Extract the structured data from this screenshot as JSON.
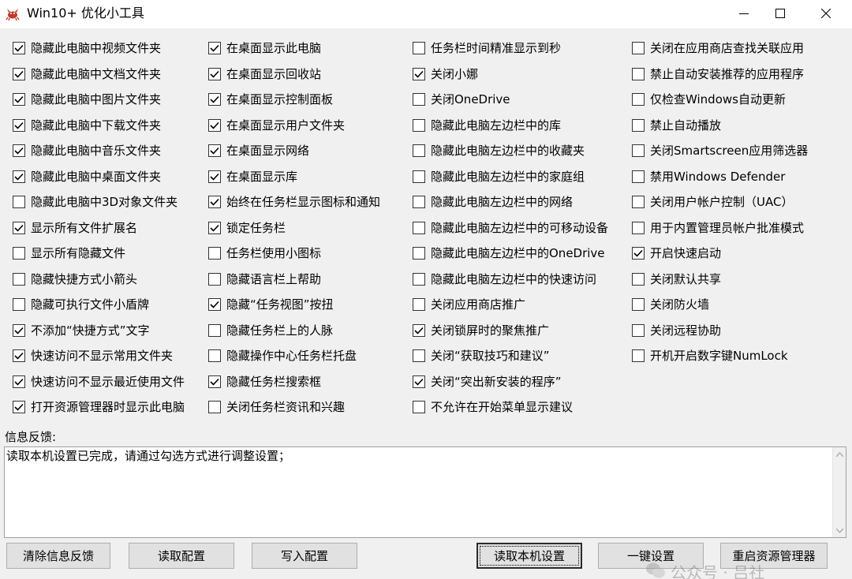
{
  "window": {
    "title": "Win10+ 优化小工具",
    "icon": "crab-app-icon"
  },
  "options": [
    [
      {
        "label": "隐藏此电脑中视频文件夹",
        "checked": true
      },
      {
        "label": "隐藏此电脑中文档文件夹",
        "checked": true
      },
      {
        "label": "隐藏此电脑中图片文件夹",
        "checked": true
      },
      {
        "label": "隐藏此电脑中下载文件夹",
        "checked": true
      },
      {
        "label": "隐藏此电脑中音乐文件夹",
        "checked": true
      },
      {
        "label": "隐藏此电脑中桌面文件夹",
        "checked": true
      },
      {
        "label": "隐藏此电脑中3D对象文件夹",
        "checked": false
      },
      {
        "label": "显示所有文件扩展名",
        "checked": true
      },
      {
        "label": "显示所有隐藏文件",
        "checked": false
      },
      {
        "label": "隐藏快捷方式小箭头",
        "checked": false
      },
      {
        "label": "隐藏可执行文件小盾牌",
        "checked": false
      },
      {
        "label": "不添加“快捷方式”文字",
        "checked": true
      },
      {
        "label": "快速访问不显示常用文件夹",
        "checked": true
      },
      {
        "label": "快速访问不显示最近使用文件",
        "checked": true
      },
      {
        "label": "打开资源管理器时显示此电脑",
        "checked": true
      }
    ],
    [
      {
        "label": "在桌面显示此电脑",
        "checked": true
      },
      {
        "label": "在桌面显示回收站",
        "checked": true
      },
      {
        "label": "在桌面显示控制面板",
        "checked": true
      },
      {
        "label": "在桌面显示用户文件夹",
        "checked": true
      },
      {
        "label": "在桌面显示网络",
        "checked": true
      },
      {
        "label": "在桌面显示库",
        "checked": true
      },
      {
        "label": "始终在任务栏显示图标和通知",
        "checked": true
      },
      {
        "label": "锁定任务栏",
        "checked": true
      },
      {
        "label": "任务栏使用小图标",
        "checked": false
      },
      {
        "label": "隐藏语言栏上帮助",
        "checked": false
      },
      {
        "label": "隐藏“任务视图”按扭",
        "checked": true
      },
      {
        "label": "隐藏任务栏上的人脉",
        "checked": false
      },
      {
        "label": "隐藏操作中心任务栏托盘",
        "checked": false
      },
      {
        "label": "隐藏任务栏搜索框",
        "checked": true
      },
      {
        "label": "关闭任务栏资讯和兴趣",
        "checked": false
      }
    ],
    [
      {
        "label": "任务栏时间精准显示到秒",
        "checked": false
      },
      {
        "label": "关闭小娜",
        "checked": true
      },
      {
        "label": "关闭OneDrive",
        "checked": false
      },
      {
        "label": "隐藏此电脑左边栏中的库",
        "checked": false
      },
      {
        "label": "隐藏此电脑左边栏中的收藏夹",
        "checked": false
      },
      {
        "label": "隐藏此电脑左边栏中的家庭组",
        "checked": false
      },
      {
        "label": "隐藏此电脑左边栏中的网络",
        "checked": false
      },
      {
        "label": "隐藏此电脑左边栏中的可移动设备",
        "checked": false
      },
      {
        "label": "隐藏此电脑左边栏中的OneDrive",
        "checked": false
      },
      {
        "label": "隐藏此电脑左边栏中的快速访问",
        "checked": false
      },
      {
        "label": "关闭应用商店推广",
        "checked": false
      },
      {
        "label": "关闭锁屏时的聚焦推广",
        "checked": true
      },
      {
        "label": "关闭“获取技巧和建议”",
        "checked": false
      },
      {
        "label": "关闭“突出新安装的程序”",
        "checked": true
      },
      {
        "label": "不允许在开始菜单显示建议",
        "checked": false
      }
    ],
    [
      {
        "label": "关闭在应用商店查找关联应用",
        "checked": false
      },
      {
        "label": "禁止自动安装推荐的应用程序",
        "checked": false
      },
      {
        "label": "仅检查Windows自动更新",
        "checked": false
      },
      {
        "label": "禁止自动播放",
        "checked": false
      },
      {
        "label": "关闭Smartscreen应用筛选器",
        "checked": false
      },
      {
        "label": "禁用Windows Defender",
        "checked": false
      },
      {
        "label": "关闭用户帐户控制（UAC）",
        "checked": false
      },
      {
        "label": "用于内置管理员帐户批准模式",
        "checked": false
      },
      {
        "label": "开启快速启动",
        "checked": true
      },
      {
        "label": "关闭默认共享",
        "checked": false
      },
      {
        "label": "关闭防火墙",
        "checked": false
      },
      {
        "label": "关闭远程协助",
        "checked": false
      },
      {
        "label": "开机开启数字键NumLock",
        "checked": false
      }
    ]
  ],
  "feedback": {
    "label": "信息反馈:",
    "text": "读取本机设置已完成，请通过勾选方式进行调整设置；"
  },
  "buttons": {
    "clear": "清除信息反馈",
    "read_config": "读取配置",
    "write_config": "写入配置",
    "read_local": "读取本机设置",
    "one_key": "一键设置",
    "restart_explorer": "重启资源管理器"
  },
  "watermark": {
    "text": "公众号 · 吕社"
  }
}
